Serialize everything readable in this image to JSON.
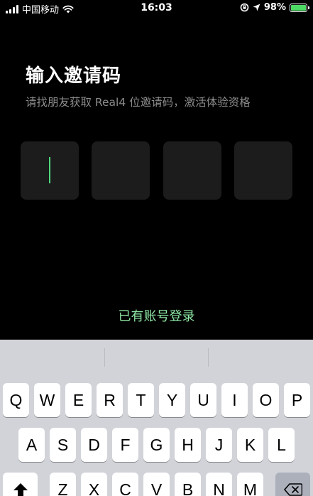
{
  "status_bar": {
    "carrier": "中国移动",
    "time": "16:03",
    "battery": "98%",
    "battery_level": 0.98
  },
  "main": {
    "title": "输入邀请码",
    "subtitle": "请找朋友获取 Real4 位邀请码，激活体验资格",
    "code_length": 4,
    "login_link": "已有账号登录"
  },
  "keyboard": {
    "row1": [
      "Q",
      "W",
      "E",
      "R",
      "T",
      "Y",
      "U",
      "I",
      "O",
      "P"
    ],
    "row2": [
      "A",
      "S",
      "D",
      "F",
      "G",
      "H",
      "J",
      "K",
      "L"
    ],
    "row3": [
      "Z",
      "X",
      "C",
      "V",
      "B",
      "N",
      "M"
    ]
  },
  "colors": {
    "accent": "#4ed77c",
    "link": "#8ce5a3",
    "background": "#000000",
    "code_box": "#1c1c1c"
  }
}
